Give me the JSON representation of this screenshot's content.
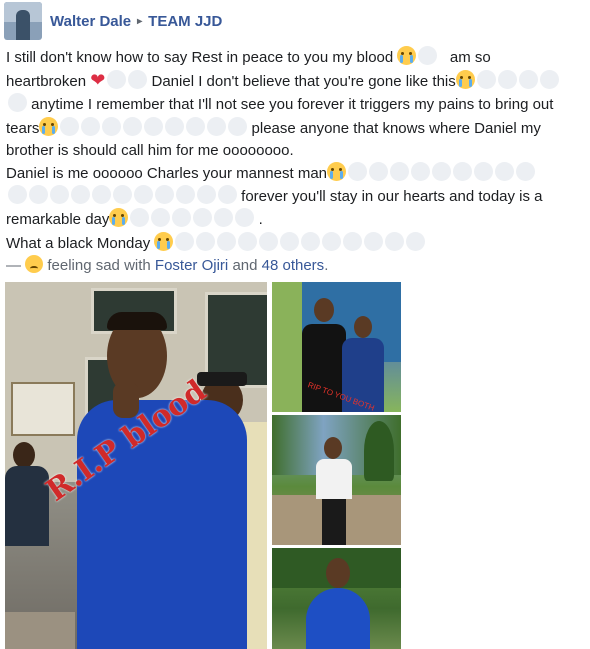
{
  "post": {
    "author": "Walter Dale",
    "separator": "▸",
    "group": "TEAM JJD",
    "lines": {
      "l1": "I still don't know how to say Rest in peace to you my blood",
      "l1b": "am so",
      "l2a": "heartbroken",
      "l2b": "Daniel I don't believe that you're gone like this",
      "l3": "anytime I remember that I'll not see you forever it triggers my pains to bring out",
      "l4a": "tears",
      "l4b": "please anyone that knows where Daniel my",
      "l5": "brother is should call him for me oooooooo.",
      "l6": "Daniel is me oooooo Charles your mannest man",
      "l7": "forever you'll stay in our hearts and today is a",
      "l8a": "remarkable day",
      "l8b": ".",
      "l9": "What a black Monday"
    },
    "feeling": {
      "dash": "—",
      "text": "feeling sad with",
      "tagged": "Foster Ojiri",
      "and": "and",
      "others": "48 others",
      "period": "."
    },
    "emoji": {
      "cry": "crying-face-icon",
      "heart": "broken-heart-icon",
      "sad": "sad-face-icon"
    },
    "photos": {
      "main_overlay": "R.I.P blood",
      "small_overlay": "RIP TO YOU BOTH"
    }
  },
  "colors": {
    "link": "#385898",
    "text": "#1c1e21",
    "muted": "#606770"
  }
}
